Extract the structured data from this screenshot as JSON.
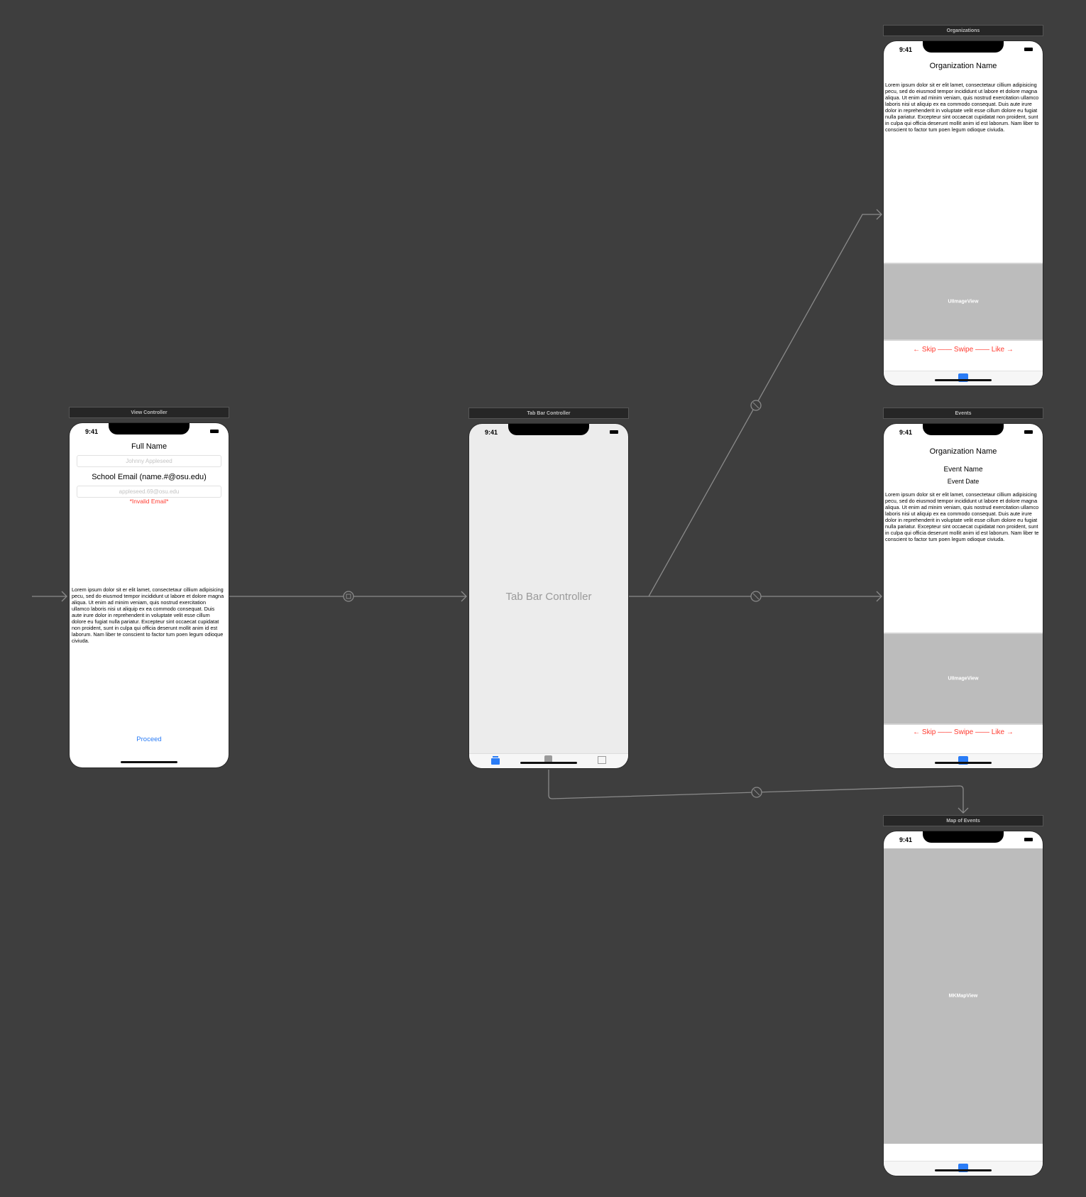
{
  "scenes": {
    "view_controller": {
      "title": "View Controller",
      "time": "9:41",
      "full_name_label": "Full Name",
      "full_name_placeholder": "Johnny Appleseed",
      "email_label": "School Email (name.#@osu.edu)",
      "email_placeholder": "appleseed.69@osu.edu",
      "error_text": "*Invalid Email*",
      "body_text": "Lorem ipsum dolor sit er elit lamet, consectetaur cillium adipisicing pecu, sed do eiusmod tempor incididunt ut labore et dolore magna aliqua. Ut enim ad minim veniam, quis nostrud exercitation ullamco laboris nisi ut aliquip ex ea commodo consequat. Duis aute irure dolor in reprehenderit in voluptate velit esse cillum dolore eu fugiat nulla pariatur. Excepteur sint occaecat cupidatat non proident, sunt in culpa qui officia deserunt mollit anim id est laborum. Nam liber te conscient to factor tum poen legum odioque civiuda.",
      "proceed_label": "Proceed"
    },
    "tab_bar_controller": {
      "title": "Tab Bar Controller",
      "time": "9:41",
      "placeholder_label": "Tab Bar Controller"
    },
    "organizations": {
      "title": "Organizations",
      "time": "9:41",
      "org_name": "Organization Name",
      "body_text": "Lorem ipsum dolor sit er elit lamet, consectetaur cillium adipisicing pecu, sed do eiusmod tempor incididunt ut labore et dolore magna aliqua. Ut enim ad minim veniam, quis nostrud exercitation ullamco laboris nisi ut aliquip ex ea commodo consequat. Duis aute irure dolor in reprehenderit in voluptate velit esse cillum dolore eu fugiat nulla pariatur. Excepteur sint occaecat cupidatat non proident, sunt in culpa qui officia deserunt mollit anim id est laborum. Nam liber to conscient to factor tum poen legum odioque civiuda.",
      "image_label": "UIImageView",
      "swipe_hint": "← Skip —— Swipe —— Like →"
    },
    "events": {
      "title": "Events",
      "time": "9:41",
      "org_name": "Organization Name",
      "event_name": "Event Name",
      "event_date": "Event Date",
      "body_text": "Lorem ipsum dolor sit er elit lamet, consectetaur cillium adipisicing pecu, sed do eiusmod tempor incididunt ut labore et dolore magna aliqua. Ut enim ad minim veniam, quis nostrud exercitation ullamco laboris nisi ut aliquip ex ea commodo consequat. Duis aute irure dolor in reprehenderit in voluptate velit esse cillum dolore eu fugiat nulla pariatur. Excepteur sint occaecat cupidatat non proident, sunt in culpa qui officia deserunt mollit anim id est laborum. Nam liber te conscient to factor tum poen legum odioque civiuda.",
      "image_label": "UIImageView",
      "swipe_hint": "← Skip —— Swipe —— Like →"
    },
    "map_of_events": {
      "title": "Map of Events",
      "time": "9:41",
      "map_label": "MKMapView"
    }
  },
  "colors": {
    "canvas": "#3e3e3e",
    "accent_blue": "#2a7cf6",
    "error_red": "#ff3b30",
    "segue_line": "#8a8a8a"
  },
  "icons": [
    "entry-arrow",
    "segue-present-icon",
    "segue-relationship-icon",
    "tab-cards-icon",
    "tab-calendar-icon",
    "tab-map-icon"
  ]
}
